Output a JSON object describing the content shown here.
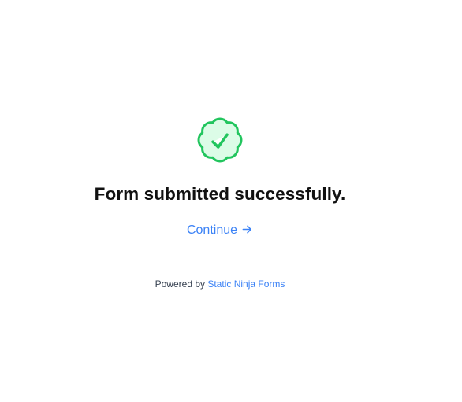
{
  "status": {
    "icon": "check-badge-icon",
    "icon_stroke_color": "#22c55e",
    "icon_fill_color": "#dcfce7",
    "title": "Form submitted successfully."
  },
  "continue_link": {
    "label": "Continue",
    "icon": "arrow-right-icon",
    "color": "#3b82f6"
  },
  "footer": {
    "powered_by_prefix": "Powered by",
    "brand_link": "Static Ninja Forms"
  }
}
